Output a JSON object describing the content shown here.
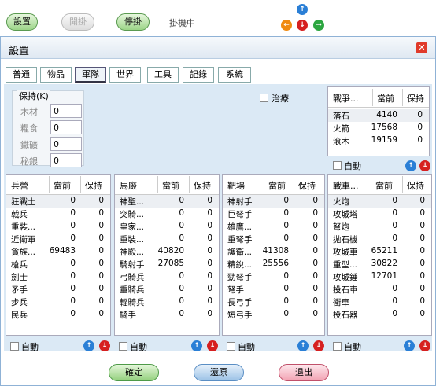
{
  "topbar": {
    "setting_label": "設置",
    "start_label": "開掛",
    "stop_label": "停掛",
    "status": "掛機中"
  },
  "dialog": {
    "title": "設置",
    "close_glyph": "✕"
  },
  "tabs": [
    "普通",
    "物品",
    "軍隊",
    "世界",
    "工具",
    "記錄",
    "系統"
  ],
  "hold": {
    "legend": "保持(K)",
    "rows": [
      {
        "label": "木材",
        "value": "0"
      },
      {
        "label": "糧食",
        "value": "0"
      },
      {
        "label": "鐵礦",
        "value": "0"
      },
      {
        "label": "秘銀",
        "value": "0"
      }
    ]
  },
  "heal_label": "治療",
  "auto_label": "自動",
  "tables": {
    "war": {
      "headers": [
        "戰爭...",
        "當前",
        "保持"
      ],
      "rows": [
        [
          "落石",
          "4140",
          "0"
        ],
        [
          "火箭",
          "17568",
          "0"
        ],
        [
          "滾木",
          "19159",
          "0"
        ]
      ]
    },
    "barracks": {
      "headers": [
        "兵營",
        "當前",
        "保持"
      ],
      "rows": [
        [
          "狂戰士",
          "0",
          "0"
        ],
        [
          "戟兵",
          "0",
          "0"
        ],
        [
          "重裝...",
          "0",
          "0"
        ],
        [
          "近衛軍",
          "0",
          "0"
        ],
        [
          "貪族...",
          "69483",
          "0"
        ],
        [
          "槍兵",
          "0",
          "0"
        ],
        [
          "劍士",
          "0",
          "0"
        ],
        [
          "矛手",
          "0",
          "0"
        ],
        [
          "步兵",
          "0",
          "0"
        ],
        [
          "民兵",
          "0",
          "0"
        ]
      ]
    },
    "stable": {
      "headers": [
        "馬廄",
        "當前",
        "保持"
      ],
      "rows": [
        [
          "神聖...",
          "0",
          "0"
        ],
        [
          "突騎...",
          "0",
          "0"
        ],
        [
          "皇家...",
          "0",
          "0"
        ],
        [
          "重裝...",
          "0",
          "0"
        ],
        [
          "神殿...",
          "40820",
          "0"
        ],
        [
          "騎射手",
          "27085",
          "0"
        ],
        [
          "弓騎兵",
          "0",
          "0"
        ],
        [
          "重騎兵",
          "0",
          "0"
        ],
        [
          "輕騎兵",
          "0",
          "0"
        ],
        [
          "騎手",
          "0",
          "0"
        ]
      ]
    },
    "range": {
      "headers": [
        "靶場",
        "當前",
        "保持"
      ],
      "rows": [
        [
          "神射手",
          "0",
          "0"
        ],
        [
          "巨弩手",
          "0",
          "0"
        ],
        [
          "雄鷹...",
          "0",
          "0"
        ],
        [
          "重弩手",
          "0",
          "0"
        ],
        [
          "護衛...",
          "41308",
          "0"
        ],
        [
          "精銳...",
          "25556",
          "0"
        ],
        [
          "勁弩手",
          "0",
          "0"
        ],
        [
          "弩手",
          "0",
          "0"
        ],
        [
          "長弓手",
          "0",
          "0"
        ],
        [
          "短弓手",
          "0",
          "0"
        ]
      ]
    },
    "workshop": {
      "headers": [
        "戰車...",
        "當前",
        "保持"
      ],
      "rows": [
        [
          "火炮",
          "0",
          "0"
        ],
        [
          "攻城塔",
          "0",
          "0"
        ],
        [
          "弩炮",
          "0",
          "0"
        ],
        [
          "拋石機",
          "0",
          "0"
        ],
        [
          "攻城車",
          "65211",
          "0"
        ],
        [
          "重型...",
          "30822",
          "0"
        ],
        [
          "攻城錘",
          "12701",
          "0"
        ],
        [
          "投石車",
          "0",
          "0"
        ],
        [
          "衝車",
          "0",
          "0"
        ],
        [
          "投石器",
          "0",
          "0"
        ]
      ]
    }
  },
  "footer": {
    "ok_label": "確定",
    "restore_label": "還原",
    "exit_label": "退出"
  },
  "icons": {
    "up": "↑",
    "down": "↓",
    "left": "←",
    "right": "→"
  },
  "colors": {
    "panel_bg": "#dbe9f5",
    "accent_blue": "#2a7fd6",
    "accent_red": "#d62020"
  }
}
